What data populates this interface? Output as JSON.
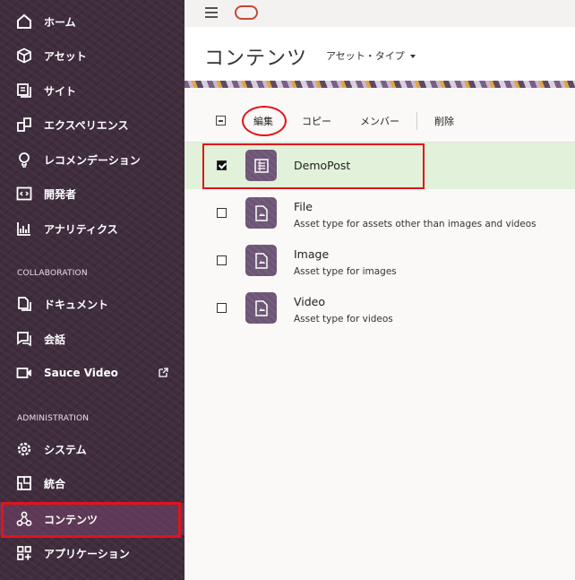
{
  "sidebar": {
    "items": [
      {
        "label": "ホーム",
        "icon": "home-icon"
      },
      {
        "label": "アセット",
        "icon": "cube-icon"
      },
      {
        "label": "サイト",
        "icon": "sites-icon"
      },
      {
        "label": "エクスペリエンス",
        "icon": "experience-icon"
      },
      {
        "label": "レコメンデーション",
        "icon": "lightbulb-icon"
      },
      {
        "label": "開発者",
        "icon": "code-icon"
      },
      {
        "label": "アナリティクス",
        "icon": "analytics-icon"
      }
    ],
    "collaboration_label": "COLLABORATION",
    "collab_items": [
      {
        "label": "ドキュメント",
        "icon": "documents-icon"
      },
      {
        "label": "会話",
        "icon": "conversation-icon"
      },
      {
        "label": "Sauce Video",
        "icon": "video-icon",
        "external": "external-link-icon"
      }
    ],
    "administration_label": "ADMINISTRATION",
    "admin_items": [
      {
        "label": "システム",
        "icon": "gear-icon"
      },
      {
        "label": "統合",
        "icon": "integration-icon"
      },
      {
        "label": "コンテンツ",
        "icon": "content-icon",
        "active": true
      },
      {
        "label": "アプリケーション",
        "icon": "apps-icon"
      }
    ]
  },
  "header": {
    "title": "コンテンツ",
    "asset_type_label": "アセット・タイプ"
  },
  "toolbar": {
    "edit": "編集",
    "copy": "コピー",
    "members": "メンバー",
    "delete": "削除"
  },
  "asset_types": [
    {
      "name": "DemoPost",
      "description": "",
      "checked": true
    },
    {
      "name": "File",
      "description": "Asset type for assets other than images and videos",
      "checked": false
    },
    {
      "name": "Image",
      "description": "Asset type for images",
      "checked": false
    },
    {
      "name": "Video",
      "description": "Asset type for videos",
      "checked": false
    }
  ],
  "colors": {
    "sidebar_bg": "#3f2c3c",
    "accent_red": "#e1141b",
    "selected_row": "#e2f1d9",
    "tile": "#6d5576",
    "oracle": "#c74634"
  }
}
